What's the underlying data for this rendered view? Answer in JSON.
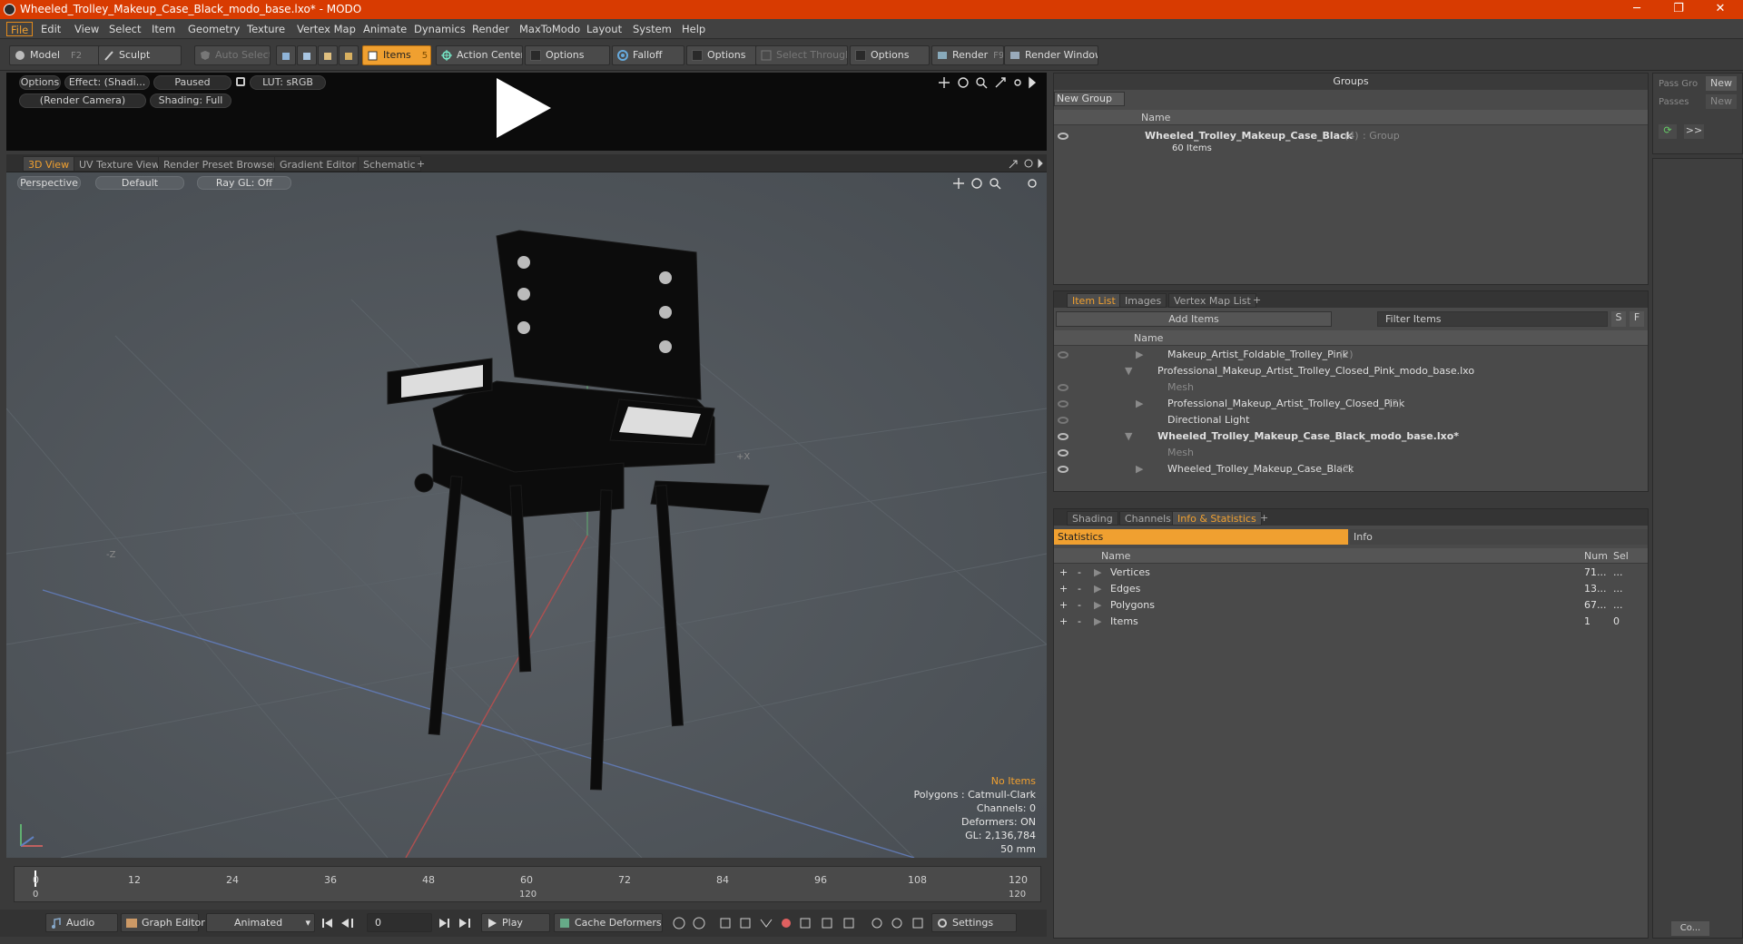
{
  "window": {
    "title": "Wheeled_Trolley_Makeup_Case_Black_modo_base.lxo* - MODO",
    "min": "─",
    "max": "❐",
    "close": "✕"
  },
  "menu": [
    "File",
    "Edit",
    "View",
    "Select",
    "Item",
    "Geometry",
    "Texture",
    "Vertex Map",
    "Animate",
    "Dynamics",
    "Render",
    "MaxToModo",
    "Layout",
    "System",
    "Help"
  ],
  "toolbar": {
    "model": "Model",
    "model_key": "F2",
    "sculpt": "Sculpt",
    "auto_select": "Auto Select",
    "items": "Items",
    "items_key": "5",
    "action_center": "Action Center",
    "options1": "Options",
    "falloff": "Falloff",
    "options2": "Options",
    "select_through": "Select Through",
    "options3": "Options",
    "render": "Render",
    "render_key": "F9",
    "render_window": "Render Window"
  },
  "render_preview": {
    "options": "Options",
    "effect": "Effect: (Shadi...",
    "paused": "Paused",
    "lut": "LUT: sRGB",
    "camera": "(Render Camera)",
    "shading": "Shading: Full"
  },
  "viewport_tabs": [
    "3D View",
    "UV Texture View",
    "Render Preset Browser",
    "Gradient Editor",
    "Schematic",
    "+"
  ],
  "viewport": {
    "perspective": "Perspective",
    "default": "Default",
    "raygl": "Ray GL: Off",
    "axis_z": "-Z",
    "axis_x": "+X",
    "hud": {
      "items": "No Items",
      "polygons": "Polygons : Catmull-Clark",
      "channels": "Channels: 0",
      "deformers": "Deformers: ON",
      "gl": "GL: 2,136,784",
      "size": "50 mm"
    }
  },
  "timeline": {
    "ticks": [
      "0",
      "12",
      "24",
      "36",
      "48",
      "60",
      "72",
      "84",
      "96",
      "108",
      "120"
    ],
    "bottom_left": "0",
    "bottom_mid": "120",
    "bottom_right": "120"
  },
  "bottombar": {
    "audio": "Audio",
    "graph_editor": "Graph Editor",
    "animated": "Animated",
    "frame": "0",
    "play": "Play",
    "cache_deformers": "Cache Deformers",
    "settings": "Settings"
  },
  "groups": {
    "title": "Groups",
    "new_group": "New Group",
    "col_name": "Name",
    "item_name": "Wheeled_Trolley_Makeup_Case_Black",
    "item_count": "(4)",
    "item_type": ": Group",
    "item_sub": "60 Items"
  },
  "pass": {
    "pass_groups": "Pass Gro",
    "passes": "Passes",
    "new1": "New",
    "new2": "New",
    "arrows": ">>"
  },
  "item_list": {
    "tabs": [
      "Item List",
      "Images",
      "Vertex Map List",
      "+"
    ],
    "add_items": "Add Items",
    "filter": "Filter Items",
    "s_btn": "S",
    "f_btn": "F",
    "col_name": "Name",
    "rows": [
      {
        "label": "Makeup_Artist_Foldable_Trolley_Pink",
        "count": "(2)"
      },
      {
        "label": "Professional_Makeup_Artist_Trolley_Closed_Pink_modo_base.lxo",
        "count": ""
      },
      {
        "label": "Mesh",
        "count": ""
      },
      {
        "label": "Professional_Makeup_Artist_Trolley_Closed_Pink",
        "count": "(2)"
      },
      {
        "label": "Directional Light",
        "count": ""
      },
      {
        "label": "Wheeled_Trolley_Makeup_Case_Black_modo_base.lxo*",
        "count": ""
      },
      {
        "label": "Mesh",
        "count": ""
      },
      {
        "label": "Wheeled_Trolley_Makeup_Case_Black",
        "count": "(2)"
      }
    ]
  },
  "info": {
    "tabs": [
      "Shading",
      "Channels",
      "Info & Statistics",
      "+"
    ],
    "statistics": "Statistics",
    "info_tab": "Info",
    "col_name": "Name",
    "col_num": "Num",
    "col_sel": "Sel",
    "rows": [
      {
        "label": "Vertices",
        "num": "71...",
        "sel": "..."
      },
      {
        "label": "Edges",
        "num": "13...",
        "sel": "..."
      },
      {
        "label": "Polygons",
        "num": "67...",
        "sel": "..."
      },
      {
        "label": "Items",
        "num": "1",
        "sel": "0"
      }
    ]
  },
  "command": {
    "label": "Co..."
  },
  "colors": {
    "accent": "#f0a030",
    "title_bar": "#d83b01"
  }
}
